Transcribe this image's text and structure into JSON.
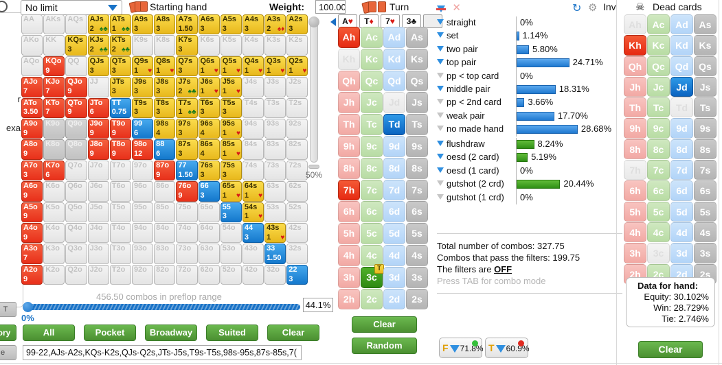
{
  "toolbar": {
    "game_type": "No limit",
    "starting_hand_label": "Starting hand",
    "weight_label": "Weight:",
    "weight_value": "100.00",
    "turn_label": "Turn",
    "inv_label": "Inv",
    "dead_cards_label": "Dead cards"
  },
  "board": [
    {
      "rank": "A",
      "suit": "♥",
      "suit_class": "suit-h"
    },
    {
      "rank": "T",
      "suit": "♦",
      "suit_class": "suit-d"
    },
    {
      "rank": "7",
      "suit": "♥",
      "suit_class": "suit-h"
    },
    {
      "rank": "3",
      "suit": "♣",
      "suit_class": "suit-c"
    },
    {
      "rank": "",
      "suit": "",
      "suit_class": ""
    }
  ],
  "matrix": {
    "ranks": [
      "A",
      "K",
      "Q",
      "J",
      "T",
      "9",
      "8",
      "7",
      "6",
      "5",
      "4",
      "3",
      "2"
    ],
    "rows": [
      [
        {
          "l": "AA",
          "s": "off"
        },
        {
          "l": "AKs",
          "s": "off"
        },
        {
          "l": "AQs",
          "s": "off"
        },
        {
          "l": "AJs",
          "s": "yel",
          "w": "2",
          "sx": "♠♣"
        },
        {
          "l": "ATs",
          "s": "yel",
          "w": "1",
          "sx": "♠♣"
        },
        {
          "l": "A9s",
          "s": "yel",
          "w": "3"
        },
        {
          "l": "A8s",
          "s": "yel",
          "w": "3"
        },
        {
          "l": "A7s",
          "s": "yel",
          "w": "1.50"
        },
        {
          "l": "A6s",
          "s": "yel",
          "w": "3"
        },
        {
          "l": "A5s",
          "s": "yel",
          "w": "3"
        },
        {
          "l": "A4s",
          "s": "yel",
          "w": "3"
        },
        {
          "l": "A3s",
          "s": "yel",
          "w": "2",
          "sx": "♠♦"
        },
        {
          "l": "A2s",
          "s": "yel",
          "w": "3"
        }
      ],
      [
        {
          "l": "AKo",
          "s": "off"
        },
        {
          "l": "KK",
          "s": "off"
        },
        {
          "l": "KQs",
          "s": "yel",
          "w": "3"
        },
        {
          "l": "KJs",
          "s": "yel",
          "w": "2",
          "sx": "♠♣"
        },
        {
          "l": "KTs",
          "s": "yel",
          "w": "2",
          "sx": "♠♣"
        },
        {
          "l": "K9s",
          "s": "off"
        },
        {
          "l": "K8s",
          "s": "off"
        },
        {
          "l": "K7s",
          "s": "yel",
          "w": "3"
        },
        {
          "l": "K6s",
          "s": "off"
        },
        {
          "l": "K5s",
          "s": "off"
        },
        {
          "l": "K4s",
          "s": "off"
        },
        {
          "l": "K3s",
          "s": "off"
        },
        {
          "l": "K2s",
          "s": "off"
        }
      ],
      [
        {
          "l": "AQo",
          "s": "off"
        },
        {
          "l": "KQo",
          "s": "red",
          "w": "9"
        },
        {
          "l": "QQ",
          "s": "off"
        },
        {
          "l": "QJs",
          "s": "yel",
          "w": "3"
        },
        {
          "l": "QTs",
          "s": "yel",
          "w": "3"
        },
        {
          "l": "Q9s",
          "s": "yel",
          "w": "1",
          "sx": "♥"
        },
        {
          "l": "Q8s",
          "s": "yel",
          "w": "1",
          "sx": "♥"
        },
        {
          "l": "Q7s",
          "s": "yel",
          "w": "3"
        },
        {
          "l": "Q6s",
          "s": "yel",
          "w": "1",
          "sx": "♥"
        },
        {
          "l": "Q5s",
          "s": "yel",
          "w": "1",
          "sx": "♥"
        },
        {
          "l": "Q4s",
          "s": "yel",
          "w": "1",
          "sx": "♥"
        },
        {
          "l": "Q3s",
          "s": "yel",
          "w": "1",
          "sx": "♥"
        },
        {
          "l": "Q2s",
          "s": "yel",
          "w": "1",
          "sx": "♥"
        }
      ],
      [
        {
          "l": "AJo",
          "s": "red",
          "w": "7"
        },
        {
          "l": "KJo",
          "s": "red",
          "w": "7"
        },
        {
          "l": "QJo",
          "s": "red",
          "w": "9"
        },
        {
          "l": "JJ",
          "s": "off"
        },
        {
          "l": "JTs",
          "s": "yel",
          "w": "3"
        },
        {
          "l": "J9s",
          "s": "yel",
          "w": "3"
        },
        {
          "l": "J8s",
          "s": "yel",
          "w": "3"
        },
        {
          "l": "J7s",
          "s": "yel",
          "w": "2",
          "sx": "♠♣"
        },
        {
          "l": "J6s",
          "s": "yel",
          "w": "1",
          "sx": "♥"
        },
        {
          "l": "J5s",
          "s": "yel",
          "w": "1",
          "sx": "♥"
        },
        {
          "l": "J4s",
          "s": "off"
        },
        {
          "l": "J3s",
          "s": "off"
        },
        {
          "l": "J2s",
          "s": "off"
        }
      ],
      [
        {
          "l": "ATo",
          "s": "red",
          "w": "3.50"
        },
        {
          "l": "KTo",
          "s": "red",
          "w": "7"
        },
        {
          "l": "QTo",
          "s": "red",
          "w": "9"
        },
        {
          "l": "JTo",
          "s": "red",
          "w": "6"
        },
        {
          "l": "TT",
          "s": "blu",
          "w": "0.75"
        },
        {
          "l": "T9s",
          "s": "yel",
          "w": "3"
        },
        {
          "l": "T8s",
          "s": "yel",
          "w": "3"
        },
        {
          "l": "T7s",
          "s": "yel",
          "w": "1",
          "sx": "♠♣"
        },
        {
          "l": "T6s",
          "s": "yel",
          "w": "3"
        },
        {
          "l": "T5s",
          "s": "yel",
          "w": "3"
        },
        {
          "l": "T4s",
          "s": "off"
        },
        {
          "l": "T3s",
          "s": "off"
        },
        {
          "l": "T2s",
          "s": "off"
        }
      ],
      [
        {
          "l": "A9o",
          "s": "red",
          "w": "9"
        },
        {
          "l": "K9o",
          "s": "offg"
        },
        {
          "l": "Q9o",
          "s": "offg"
        },
        {
          "l": "J9o",
          "s": "red",
          "w": "9"
        },
        {
          "l": "T9o",
          "s": "red",
          "w": "9"
        },
        {
          "l": "99",
          "s": "blu",
          "w": "6"
        },
        {
          "l": "98s",
          "s": "yel",
          "w": "4"
        },
        {
          "l": "97s",
          "s": "yel",
          "w": "3"
        },
        {
          "l": "96s",
          "s": "yel",
          "w": "4"
        },
        {
          "l": "95s",
          "s": "yel",
          "w": "1",
          "sx": "♥"
        },
        {
          "l": "94s",
          "s": "off"
        },
        {
          "l": "93s",
          "s": "off"
        },
        {
          "l": "92s",
          "s": "off"
        }
      ],
      [
        {
          "l": "A8o",
          "s": "red",
          "w": "9"
        },
        {
          "l": "K8o",
          "s": "offg"
        },
        {
          "l": "Q8o",
          "s": "offg"
        },
        {
          "l": "J8o",
          "s": "red",
          "w": "9"
        },
        {
          "l": "T8o",
          "s": "red",
          "w": "9"
        },
        {
          "l": "98o",
          "s": "red",
          "w": "12"
        },
        {
          "l": "88",
          "s": "blu",
          "w": "6"
        },
        {
          "l": "87s",
          "s": "yel",
          "w": "3"
        },
        {
          "l": "86s",
          "s": "yel",
          "w": "4"
        },
        {
          "l": "85s",
          "s": "yel",
          "w": "1",
          "sx": "♥"
        },
        {
          "l": "84s",
          "s": "off"
        },
        {
          "l": "83s",
          "s": "off"
        },
        {
          "l": "82s",
          "s": "off"
        }
      ],
      [
        {
          "l": "A7o",
          "s": "red",
          "w": "3"
        },
        {
          "l": "K7o",
          "s": "red",
          "w": "6"
        },
        {
          "l": "Q7o",
          "s": "off"
        },
        {
          "l": "J7o",
          "s": "off"
        },
        {
          "l": "T7o",
          "s": "off"
        },
        {
          "l": "97o",
          "s": "off"
        },
        {
          "l": "87o",
          "s": "red",
          "w": "9"
        },
        {
          "l": "77",
          "s": "blu",
          "w": "1.50"
        },
        {
          "l": "76s",
          "s": "yel",
          "w": "3"
        },
        {
          "l": "75s",
          "s": "yel",
          "w": "3"
        },
        {
          "l": "74s",
          "s": "off"
        },
        {
          "l": "73s",
          "s": "off"
        },
        {
          "l": "72s",
          "s": "off"
        }
      ],
      [
        {
          "l": "A6o",
          "s": "red",
          "w": "9"
        },
        {
          "l": "K6o",
          "s": "off"
        },
        {
          "l": "Q6o",
          "s": "off"
        },
        {
          "l": "J6o",
          "s": "off"
        },
        {
          "l": "T6o",
          "s": "off"
        },
        {
          "l": "96o",
          "s": "off"
        },
        {
          "l": "86o",
          "s": "off"
        },
        {
          "l": "76o",
          "s": "red",
          "w": "9"
        },
        {
          "l": "66",
          "s": "blu",
          "w": "3"
        },
        {
          "l": "65s",
          "s": "yel",
          "w": "1",
          "sx": "♥"
        },
        {
          "l": "64s",
          "s": "yel",
          "w": "1",
          "sx": "♥"
        },
        {
          "l": "63s",
          "s": "off"
        },
        {
          "l": "62s",
          "s": "off"
        }
      ],
      [
        {
          "l": "A5o",
          "s": "red",
          "w": "9"
        },
        {
          "l": "K5o",
          "s": "off"
        },
        {
          "l": "Q5o",
          "s": "off"
        },
        {
          "l": "J5o",
          "s": "off"
        },
        {
          "l": "T5o",
          "s": "off"
        },
        {
          "l": "95o",
          "s": "off"
        },
        {
          "l": "85o",
          "s": "off"
        },
        {
          "l": "75o",
          "s": "off"
        },
        {
          "l": "65o",
          "s": "off"
        },
        {
          "l": "55",
          "s": "blu",
          "w": "3"
        },
        {
          "l": "54s",
          "s": "yel",
          "w": "1",
          "sx": "♥"
        },
        {
          "l": "53s",
          "s": "off"
        },
        {
          "l": "52s",
          "s": "off"
        }
      ],
      [
        {
          "l": "A4o",
          "s": "red",
          "w": "9"
        },
        {
          "l": "K4o",
          "s": "off"
        },
        {
          "l": "Q4o",
          "s": "off"
        },
        {
          "l": "J4o",
          "s": "off"
        },
        {
          "l": "T4o",
          "s": "off"
        },
        {
          "l": "94o",
          "s": "off"
        },
        {
          "l": "84o",
          "s": "off"
        },
        {
          "l": "74o",
          "s": "off"
        },
        {
          "l": "64o",
          "s": "off"
        },
        {
          "l": "54o",
          "s": "off"
        },
        {
          "l": "44",
          "s": "blu",
          "w": "3"
        },
        {
          "l": "43s",
          "s": "yel",
          "w": "1",
          "sx": "♥"
        },
        {
          "l": "42s",
          "s": "off"
        }
      ],
      [
        {
          "l": "A3o",
          "s": "red",
          "w": "7"
        },
        {
          "l": "K3o",
          "s": "off"
        },
        {
          "l": "Q3o",
          "s": "off"
        },
        {
          "l": "J3o",
          "s": "off"
        },
        {
          "l": "T3o",
          "s": "off"
        },
        {
          "l": "93o",
          "s": "off"
        },
        {
          "l": "83o",
          "s": "off"
        },
        {
          "l": "73o",
          "s": "off"
        },
        {
          "l": "63o",
          "s": "off"
        },
        {
          "l": "53o",
          "s": "off"
        },
        {
          "l": "43o",
          "s": "off"
        },
        {
          "l": "33",
          "s": "blu",
          "w": "1.50"
        },
        {
          "l": "32s",
          "s": "off"
        }
      ],
      [
        {
          "l": "A2o",
          "s": "red",
          "w": "9"
        },
        {
          "l": "K2o",
          "s": "off"
        },
        {
          "l": "Q2o",
          "s": "off"
        },
        {
          "l": "J2o",
          "s": "off"
        },
        {
          "l": "T2o",
          "s": "off"
        },
        {
          "l": "92o",
          "s": "off"
        },
        {
          "l": "82o",
          "s": "off"
        },
        {
          "l": "72o",
          "s": "off"
        },
        {
          "l": "62o",
          "s": "off"
        },
        {
          "l": "52o",
          "s": "off"
        },
        {
          "l": "42o",
          "s": "off"
        },
        {
          "l": "32o",
          "s": "off"
        },
        {
          "l": "22",
          "s": "blu",
          "w": "3"
        }
      ]
    ]
  },
  "range_slider": {
    "combos_text": "456.50 combos in preflop range",
    "min_label": "0%",
    "value_label": "44.1%"
  },
  "weight_slider": {
    "value_label": "50%"
  },
  "range_buttons": [
    "All",
    "Pocket",
    "Broadway",
    "Suited",
    "Clear"
  ],
  "range_input": "99-22,AJs-A2s,KQs-K2s,QJs-Q2s,JTs-J5s,T9s-T5s,98s-95s,87s-85s,7(",
  "card_selector": {
    "ranks": [
      "A",
      "K",
      "Q",
      "J",
      "T",
      "9",
      "8",
      "7",
      "6",
      "5",
      "4",
      "3",
      "2"
    ],
    "suits": [
      "h",
      "c",
      "d",
      "s"
    ],
    "selected": {
      "Ah": "red",
      "Td": "blue",
      "7h": "red",
      "3c": "green"
    },
    "dimmed": [
      "Kh",
      "Jd"
    ],
    "badges": {
      "3c": "T"
    }
  },
  "dead_cards": {
    "ranks": [
      "A",
      "K",
      "Q",
      "J",
      "T",
      "9",
      "8",
      "7",
      "6",
      "5",
      "4",
      "3",
      "2"
    ],
    "suits": [
      "h",
      "c",
      "d",
      "s"
    ],
    "selected": {
      "Kh": "red",
      "Jd": "blue"
    },
    "dimmed": [
      "Ah",
      "Td",
      "7h",
      "3c"
    ]
  },
  "middle_buttons": [
    "Clear",
    "Random"
  ],
  "filter_badges": [
    {
      "letter": "F",
      "value": "71.8%",
      "dot_color": "#35c03a"
    },
    {
      "letter": "T",
      "value": "60.9%",
      "dot_color": "#e02a20"
    }
  ],
  "filters": {
    "made_hands": [
      {
        "name": "straight",
        "value": "0%",
        "pct": 0,
        "on": true,
        "color": "blue"
      },
      {
        "name": "set",
        "value": "1.14%",
        "pct": 1.14,
        "on": true,
        "color": "blue"
      },
      {
        "name": "two pair",
        "value": "5.80%",
        "pct": 5.8,
        "on": true,
        "color": "blue"
      },
      {
        "name": "top pair",
        "value": "24.71%",
        "pct": 24.71,
        "on": true,
        "color": "blue"
      },
      {
        "name": "pp < top card",
        "value": "0%",
        "pct": 0,
        "on": false,
        "color": "blue"
      },
      {
        "name": "middle pair",
        "value": "18.31%",
        "pct": 18.31,
        "on": true,
        "color": "blue"
      },
      {
        "name": "pp < 2nd card",
        "value": "3.66%",
        "pct": 3.66,
        "on": false,
        "color": "blue"
      },
      {
        "name": "weak pair",
        "value": "17.70%",
        "pct": 17.7,
        "on": false,
        "color": "blue"
      },
      {
        "name": "no made hand",
        "value": "28.68%",
        "pct": 28.68,
        "on": false,
        "color": "blue"
      }
    ],
    "draws": [
      {
        "name": "flushdraw",
        "value": "8.24%",
        "pct": 8.24,
        "on": true,
        "color": "green"
      },
      {
        "name": "oesd (2 card)",
        "value": "5.19%",
        "pct": 5.19,
        "on": true,
        "color": "green"
      },
      {
        "name": "oesd (1 card)",
        "value": "0%",
        "pct": 0,
        "on": true,
        "color": "green"
      },
      {
        "name": "gutshot (2 crd)",
        "value": "20.44%",
        "pct": 20.44,
        "on": false,
        "color": "green"
      },
      {
        "name": "gutshot (1 crd)",
        "value": "0%",
        "pct": 0,
        "on": false,
        "color": "green"
      }
    ]
  },
  "summary": {
    "total_combos": "Total number of combos: 327.75",
    "passing_combos": "Combos that pass the filters: 199.75",
    "filters_state_prefix": "The filters are ",
    "filters_state": "OFF",
    "hint": "Press TAB for combo mode"
  },
  "data_for_hand": {
    "title": "Data for hand:",
    "equity": "Equity: 30.102%",
    "win": "Win: 28.729%",
    "tie": "Tie: 2.746%"
  },
  "right_clear_button": "Clear",
  "left_panel": {
    "text_top": "r",
    "text_bottom": "exa",
    "history_button": "tory",
    "grey_button": "e",
    "t_button": "T"
  }
}
